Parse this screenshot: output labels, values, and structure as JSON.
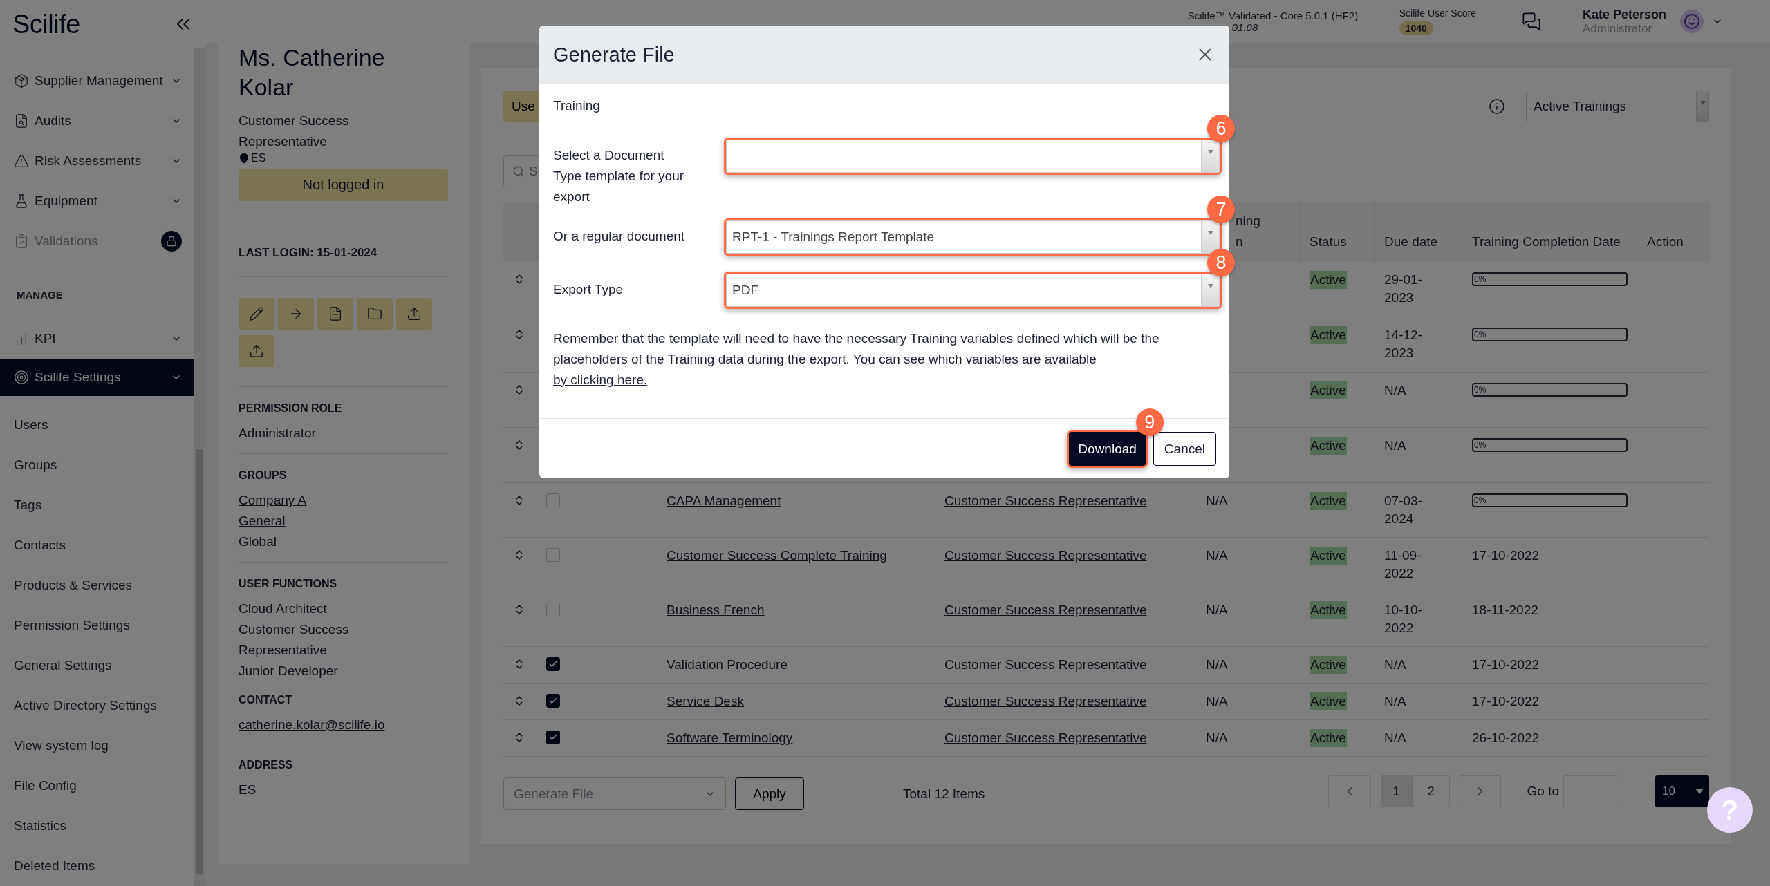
{
  "sidebar": {
    "logo": "Scilife",
    "modules": [
      {
        "label": "Supplier Management",
        "locked": false
      },
      {
        "label": "Audits",
        "locked": false
      },
      {
        "label": "Risk Assessments",
        "locked": false
      },
      {
        "label": "Equipment",
        "locked": false
      },
      {
        "label": "Validations",
        "locked": true
      }
    ],
    "manage_heading": "MANAGE",
    "manage": [
      {
        "label": "KPI",
        "selected": false
      },
      {
        "label": "Scilife Settings",
        "selected": true,
        "children": [
          {
            "label": "Users"
          },
          {
            "label": "Groups"
          },
          {
            "label": "Tags"
          },
          {
            "label": "Contacts"
          },
          {
            "label": "Products & Services"
          },
          {
            "label": "Permission Settings"
          },
          {
            "label": "General Settings"
          },
          {
            "label": "Active Directory Settings"
          },
          {
            "label": "View system log"
          },
          {
            "label": "File Config"
          },
          {
            "label": "Statistics"
          },
          {
            "label": "Deleted Items"
          }
        ]
      }
    ]
  },
  "header": {
    "brand": "Scilife™",
    "version": "Validated - Core 5.0.1 (HF2)",
    "version_date": "01.08",
    "score_label": "Scilife User Score",
    "score": "1040",
    "user_name": "Kate Peterson",
    "user_role": "Administrator"
  },
  "profile": {
    "name": "Ms. Catherine Kolar",
    "role": "Customer Success Representative",
    "location": "ES",
    "login_status": "Not logged in",
    "last_login": "LAST LOGIN: 15-01-2024",
    "sections": [
      {
        "heading": "PERMISSION ROLE",
        "kind": "text",
        "items": [
          "Administrator"
        ]
      },
      {
        "heading": "GROUPS",
        "kind": "links",
        "items": [
          "Company A",
          "General",
          "Global"
        ]
      },
      {
        "heading": "USER FUNCTIONS",
        "kind": "text",
        "items": [
          "Cloud Architect",
          "Customer Success Representative",
          "Junior Developer"
        ]
      },
      {
        "heading": "CONTACT",
        "kind": "links",
        "items": [
          "catherine.kolar@scilife.io"
        ]
      },
      {
        "heading": "ADDRESS",
        "kind": "text",
        "items": [
          "ES"
        ]
      }
    ]
  },
  "main": {
    "user_button": "Use",
    "search_placeholder": "S",
    "filter": "Active Trainings",
    "table": {
      "columns": [
        {
          "label": "ning\nn"
        },
        {
          "label": "Status"
        },
        {
          "label": "Due date"
        },
        {
          "label": "Training Completion Date"
        },
        {
          "label": "Action"
        }
      ],
      "rows": [
        {
          "status": "Active",
          "due": "29-01-2023",
          "completion": {
            "kind": "progress",
            "level": 0,
            "text": "0%"
          }
        },
        {
          "status": "Active",
          "due": "14-12-2023",
          "completion": {
            "kind": "progress",
            "level": 0,
            "text": "0%"
          }
        },
        {
          "status": "Active",
          "due": "N/A",
          "completion": {
            "kind": "progress",
            "level": 0,
            "text": "0%"
          }
        },
        {
          "status": "Active",
          "due": "N/A",
          "completion": {
            "kind": "progress",
            "level": 0,
            "text": "0%"
          }
        },
        {
          "checked": false,
          "name": "CAPA Management",
          "role": "Customer Success Representative",
          "version": "N/A",
          "status": "Active",
          "due": "07-03-2024",
          "completion": {
            "kind": "progress",
            "level": 0,
            "text": "0%"
          }
        },
        {
          "checked": false,
          "name": "Customer Success Complete Training",
          "role": "Customer Success Representative",
          "version": "N/A",
          "status": "Active",
          "due": "11-09-2022",
          "completion": {
            "kind": "date",
            "text": "17-10-2022"
          }
        },
        {
          "checked": false,
          "name": "Business French",
          "role": "Customer Success Representative",
          "version": "N/A",
          "status": "Active",
          "due": "10-10-2022",
          "completion": {
            "kind": "date",
            "text": "18-11-2022"
          }
        },
        {
          "checked": true,
          "name": "Validation Procedure",
          "role": "Customer Success Representative",
          "version": "N/A",
          "status": "Active",
          "due": "N/A",
          "completion": {
            "kind": "date",
            "text": "17-10-2022"
          }
        },
        {
          "checked": true,
          "name": "Service Desk",
          "role": "Customer Success Representative",
          "version": "N/A",
          "status": "Active",
          "due": "N/A",
          "completion": {
            "kind": "date",
            "text": "17-10-2022"
          }
        },
        {
          "checked": true,
          "name": "Software Terminology",
          "role": "Customer Success Representative",
          "version": "N/A",
          "status": "Active",
          "due": "N/A",
          "completion": {
            "kind": "date",
            "text": "26-10-2022"
          }
        }
      ]
    },
    "bulk_action": "Generate File",
    "apply": "Apply",
    "total": "Total 12 Items",
    "pagination": {
      "pages": [
        {
          "label": "1",
          "selected": true
        },
        {
          "label": "2",
          "selected": false
        }
      ],
      "go_to": "Go to",
      "page_size": "10"
    }
  },
  "modal": {
    "title": "Generate File",
    "section": "Training",
    "fields": [
      {
        "label": "Select a Document Type template for your export",
        "callout": "6"
      },
      {
        "label": "Or a regular document",
        "value": "RPT-1 - Trainings Report Template",
        "callout": "7"
      },
      {
        "label": "Export Type",
        "value": "PDF",
        "callout": "8"
      }
    ],
    "note": "Remember that the template will need to have the necessary Training variables defined which will be the placeholders of the Training data during the export. You can see which variables are available ",
    "note_link": "by clicking here.",
    "download": {
      "label": "Download",
      "callout": "9"
    },
    "cancel": "Cancel"
  },
  "help_button": "?"
}
